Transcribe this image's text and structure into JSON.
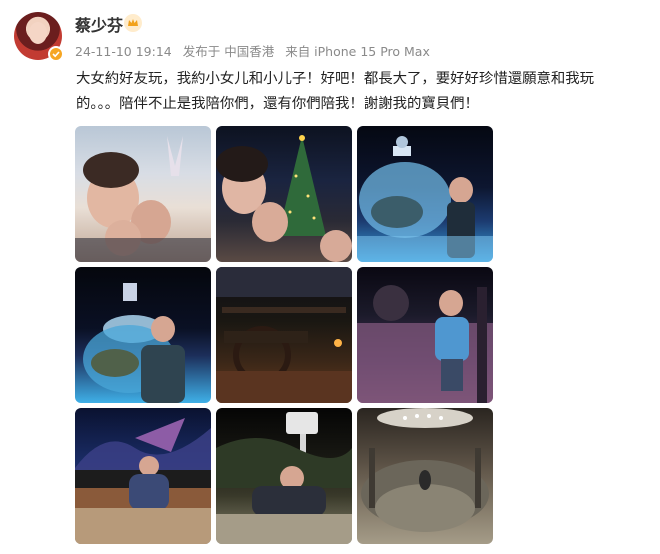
{
  "post": {
    "author": "蔡少芬",
    "date": "24-11-10 19:14",
    "published_in": "发布于 中国香港",
    "source": "来自 iPhone 15 Pro Max",
    "text_line1": "大女約好友玩，我約小女儿和小儿子！好吧！都長大了，要好好珍惜還願意和我玩",
    "text_line2": "的。。。陪伴不止是我陪你們，還有你們陪我！謝謝我的寶貝們！",
    "photo_count": 9
  },
  "icons": {
    "avatar": "avatar",
    "verified": "verified-badge-icon",
    "vip": "crown-icon"
  },
  "colors": {
    "verified": "#f6a623",
    "meta_text": "#8a8a8a"
  }
}
